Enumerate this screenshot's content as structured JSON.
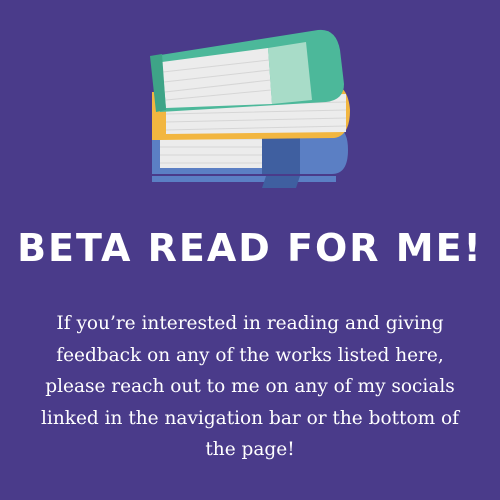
{
  "heading": {
    "title": "BETA READ FOR ME!"
  },
  "body": {
    "text": "If you’re interested in reading and giving feedback on any of the works listed here, please reach out to me on any of my socials linked in the navigation bar or the bottom of the page!"
  },
  "illustration": {
    "icon": "book-stack-icon",
    "colors": {
      "background": "#4a3b8a",
      "top_book_cover": "#4cb89a",
      "top_book_spine": "#a8dcc8",
      "middle_book_cover": "#f2b640",
      "bottom_book_cover": "#5b7fc4",
      "bottom_book_spine": "#3f5fa0",
      "pages": "#ececec"
    }
  }
}
